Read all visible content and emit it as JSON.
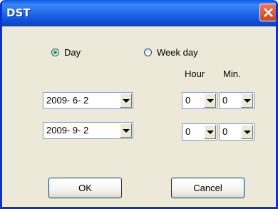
{
  "window": {
    "title": "DST"
  },
  "mode": {
    "day_label": "Day",
    "weekday_label": "Week day",
    "selected": "Day"
  },
  "headers": {
    "hour": "Hour",
    "min": "Min."
  },
  "rows": [
    {
      "date": "2009- 6- 2",
      "hour": "0",
      "min": "0"
    },
    {
      "date": "2009- 9- 2",
      "hour": "0",
      "min": "0"
    }
  ],
  "buttons": {
    "ok": "OK",
    "cancel": "Cancel"
  }
}
